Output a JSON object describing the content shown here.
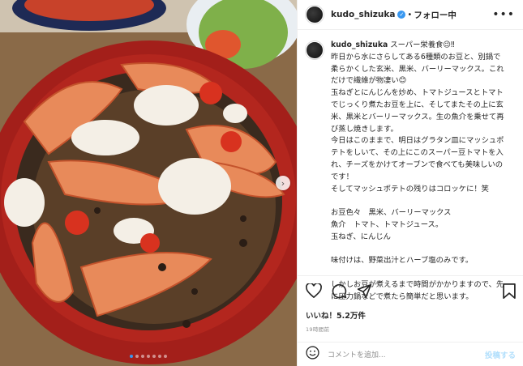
{
  "post": {
    "username": "kudo_shizuka",
    "verified_badge": "✓",
    "separator": "•",
    "follow_status": "フォロー中",
    "more_icon": "ellipsis-icon"
  },
  "caption": {
    "username": "kudo_shizuka",
    "lines": [
      "スーパー栄養食😉‼",
      "昨日から水にさらしてある6種類のお豆と、別鍋で",
      "柔らかくした玄米、黒米、バーリーマックス。これ",
      "だけで繊維が物凄い😊",
      "玉ねぎとにんじんを炒め、トマトジュースとトマト",
      "でじっくり煮たお豆を上に、そしてまたその上に玄",
      "米、黒米とバーリーマックス。生の魚介を乗せて再",
      "び蒸し焼きします。",
      "今日はこのままで、明日はグラタン皿にマッシュポ",
      "テトをしいて、その上にこのスーパー豆トマトを入",
      "れ、チーズをかけてオーブンで食べても美味しいの",
      "です！",
      "そしてマッシュポテトの残りはコロッケに！笑",
      "",
      "お豆色々　黒米、バーリーマックス",
      "魚介　トマト、トマトジュース。",
      "玉ねぎ、にんじん",
      "",
      "味付けは、野菜出汁とハーブ塩のみです。",
      "",
      "しかしお豆が煮えるまで時間がかかりますので、先",
      "に圧力鍋などで煮たら簡単だと思います。"
    ]
  },
  "actions": {
    "likes": "いいね！5.2万件",
    "timestamp": "19時間前"
  },
  "comment": {
    "placeholder": "コメントを追加...",
    "post_label": "投稿する"
  },
  "carousel": {
    "slide_count": 7,
    "active_index": 0
  },
  "colors": {
    "accent": "#3897f0",
    "post_disabled": "#b2dffc",
    "border": "#efefef",
    "muted": "#8e8e8e"
  }
}
